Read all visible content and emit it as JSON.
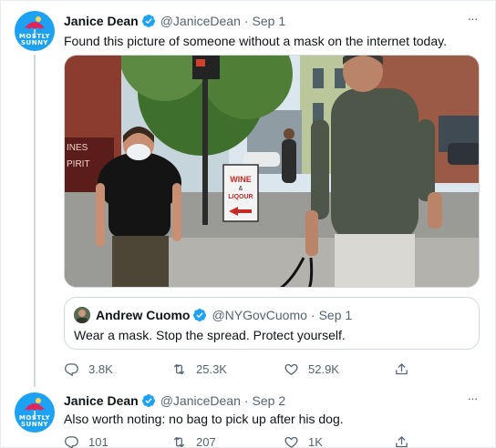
{
  "tweets": [
    {
      "name": "Janice Dean",
      "handle": "@JaniceDean",
      "separator": "·",
      "date": "Sep 1",
      "avatar_text": [
        "MOSTLY",
        "SUNNY"
      ],
      "text": "Found this picture of someone without a mask on the internet today.",
      "photo": {
        "sign_lines": [
          "WINE",
          "&",
          "LIQOUR"
        ],
        "store_lines": [
          "INES",
          "PIRIT"
        ]
      },
      "quote": {
        "name": "Andrew Cuomo",
        "handle": "@NYGovCuomo",
        "separator": "·",
        "date": "Sep 1",
        "text": "Wear a mask. Stop the spread. Protect yourself."
      },
      "actions": {
        "replies": "3.8K",
        "retweets": "25.3K",
        "likes": "52.9K"
      }
    },
    {
      "name": "Janice Dean",
      "handle": "@JaniceDean",
      "separator": "·",
      "date": "Sep 2",
      "avatar_text": [
        "MOSTLY",
        "SUNNY"
      ],
      "text": "Also worth noting: no bag to pick up after his dog.",
      "actions": {
        "replies": "101",
        "retweets": "207",
        "likes": "1K"
      }
    }
  ],
  "more_glyph": "···",
  "colors": {
    "accent": "#1da1f2",
    "muted": "#536471",
    "border": "#cfd9de",
    "text": "#0f1419"
  },
  "icons": [
    "verified-badge-icon",
    "more-icon",
    "reply-icon",
    "retweet-icon",
    "like-icon",
    "share-icon"
  ]
}
